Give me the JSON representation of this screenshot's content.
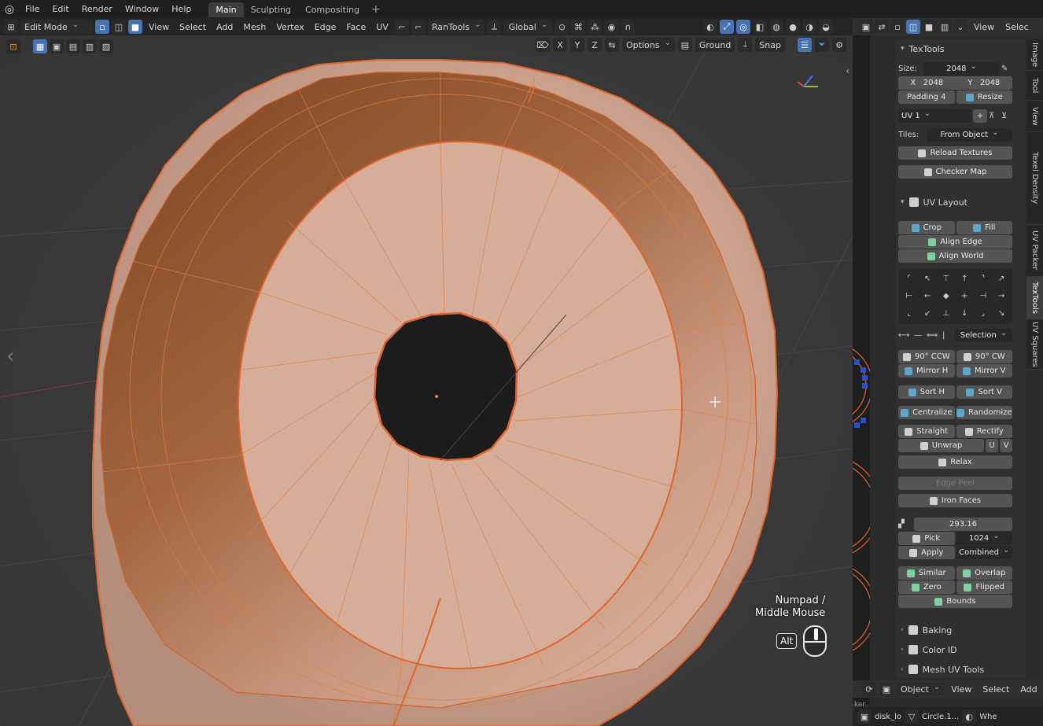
{
  "menu": {
    "items": [
      "File",
      "Edit",
      "Render",
      "Window",
      "Help"
    ],
    "workspaces": [
      {
        "label": "Main",
        "active": true
      },
      {
        "label": "Sculpting",
        "active": false
      },
      {
        "label": "Compositing",
        "active": false
      }
    ],
    "add": "+"
  },
  "viewport_header": {
    "mode": "Edit Mode",
    "menus": [
      "View",
      "Select",
      "Add",
      "Mesh",
      "Vertex",
      "Edge",
      "Face",
      "UV"
    ],
    "addon": "RanTools",
    "transform_orientation": "Global",
    "axes": [
      "X",
      "Y",
      "Z"
    ],
    "options": "Options",
    "ground": "Ground",
    "snap": "Snap"
  },
  "viewport": {
    "hint_line1": "Numpad /",
    "hint_line2": "Middle Mouse",
    "alt_key": "Alt",
    "colors": {
      "background": "#3a3a3a",
      "mesh": "#c89a85",
      "inner": "#7a4a2a",
      "edge": "#e0652a",
      "hole": "#1e1e1e"
    }
  },
  "right_header": {
    "menus": [
      "View",
      "Selec"
    ]
  },
  "vertical_tabs": [
    "Image",
    "Tool",
    "View",
    "Texel Density",
    "UV Packer",
    "TexTools",
    "UV Squares"
  ],
  "textools": {
    "title": "TexTools",
    "size_label": "Size:",
    "size_value": "2048",
    "x_label": "X",
    "x_value": "2048",
    "y_label": "Y",
    "y_value": "2048",
    "padding_label": "Padding",
    "padding_value": "4",
    "resize": "Resize",
    "uv_channel": "UV 1",
    "tiles_label": "Tiles:",
    "tiles_value": "From Object",
    "reload": "Reload Textures",
    "checker": "Checker Map"
  },
  "uv_layout": {
    "title": "UV Layout",
    "crop": "Crop",
    "fill": "Fill",
    "align_edge": "Align Edge",
    "align_world": "Align World",
    "selection": "Selection",
    "rot_ccw": "90° CCW",
    "rot_cw": "90° CW",
    "mirror_h": "Mirror H",
    "mirror_v": "Mirror V",
    "sort_h": "Sort H",
    "sort_v": "Sort V",
    "centralize": "Centralize",
    "randomize": "Randomize",
    "straight": "Straight",
    "rectify": "Rectify",
    "unwrap": "Unwrap",
    "u": "U",
    "v": "V",
    "relax": "Relax",
    "edge_peel": "Edge Peel",
    "iron_faces": "Iron Faces",
    "texel_value": "293.16",
    "pick": "Pick",
    "pick_value": "1024",
    "apply": "Apply",
    "apply_value": "Combined",
    "similar": "Similar",
    "overlap": "Overlap",
    "zero": "Zero",
    "flipped": "Flipped",
    "bounds": "Bounds"
  },
  "sections": [
    "Baking",
    "Color ID",
    "Mesh UV Tools"
  ],
  "footer": {
    "mode": "Object",
    "menus": [
      "View",
      "Select",
      "Add"
    ],
    "partial": "ker",
    "status_a": "disk_lo",
    "status_b": "Circle.1...",
    "status_c": "Whe"
  }
}
